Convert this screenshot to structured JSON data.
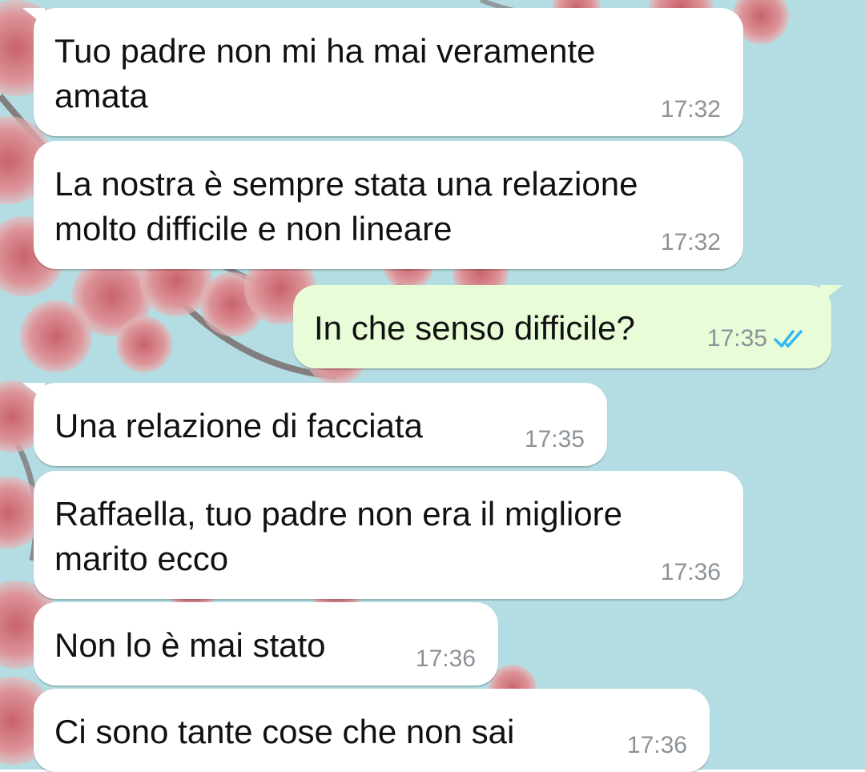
{
  "messages": [
    {
      "direction": "in",
      "text": "Tuo padre non mi ha mai veramente\namata",
      "time": "17:32"
    },
    {
      "direction": "in",
      "text": "La nostra è sempre stata una relazione\nmolto difficile e non lineare",
      "time": "17:32"
    },
    {
      "direction": "out",
      "text": "In che senso difficile?",
      "time": "17:35",
      "status_icon": "double-check-icon",
      "status_color": "#34b7f1"
    },
    {
      "direction": "in",
      "text": "Una relazione di facciata",
      "time": "17:35"
    },
    {
      "direction": "in",
      "text": "Raffaella, tuo padre non era il migliore\nmarito ecco",
      "time": "17:36"
    },
    {
      "direction": "in",
      "text": "Non lo è mai stato",
      "time": "17:36"
    },
    {
      "direction": "in",
      "text": "Ci sono tante cose che non sai",
      "time": "17:36"
    }
  ],
  "colors": {
    "incoming_bubble": "#ffffff",
    "outgoing_bubble": "#e7fcd7",
    "wallpaper": "#b3dde2",
    "blossom": "#d9868a",
    "timestamp": "#8c9297"
  }
}
